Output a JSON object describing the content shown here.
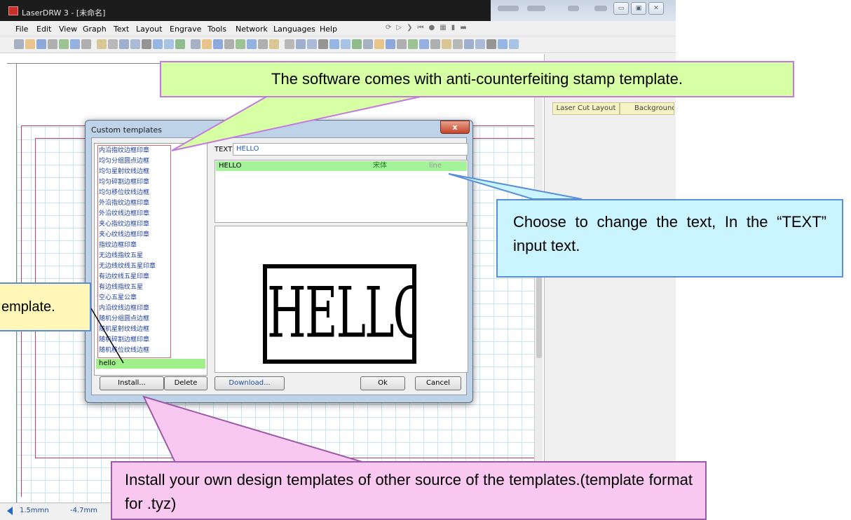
{
  "window": {
    "title": "LaserDRW 3 - [未命名]",
    "controls": [
      "▭",
      "▣",
      "✕"
    ]
  },
  "menu": [
    {
      "label": "File",
      "key": "F"
    },
    {
      "label": "Edit",
      "key": "E"
    },
    {
      "label": "View",
      "key": "V"
    },
    {
      "label": "Graph",
      "key": ""
    },
    {
      "label": "Text",
      "key": "T"
    },
    {
      "label": "Layout",
      "key": ""
    },
    {
      "label": "Engrave",
      "key": ""
    },
    {
      "label": "Tools",
      "key": ""
    },
    {
      "label": "Network",
      "key": "N"
    },
    {
      "label": "Languages",
      "key": "L"
    },
    {
      "label": "Help",
      "key": "H"
    }
  ],
  "ruler": {
    "unit": "mm"
  },
  "right_panel": {
    "tab_laser": "Laser Cut Layout",
    "tab_background": "Background"
  },
  "status": {
    "x": "1.5mmn",
    "y": "-4.7mm"
  },
  "dialog": {
    "title": "Custom templates",
    "close": "x",
    "templates": [
      "内沿指纹边框印章",
      "均匀分组圆点边框",
      "均匀星射纹线边框",
      "均匀碎割边框印章",
      "均匀移位纹线边框",
      "外沿指纹边框印章",
      "外沿纹线边框印章",
      "夹心指纹边框印章",
      "夹心纹线边框印章",
      "指纹边框印章",
      "无边线指纹五星",
      "无边线纹线五星印章",
      "有边纹线五星印章",
      "有边线指纹五星",
      "空心五星公章",
      "内沿纹线边框印章",
      "随机分组圆点边框",
      "随机星射纹线边框",
      "随机碎割边框印章",
      "随机移位纹线边框"
    ],
    "selected_template": "hello",
    "text_label": "TEXT",
    "text_value": "HELLO",
    "text_rows": [
      {
        "text": "HELLO",
        "font": "宋体",
        "mode": "line"
      }
    ],
    "preview_text": "HELLO",
    "buttons": {
      "install": "Install...",
      "delete": "Delete",
      "download": "Download...",
      "ok": "Ok",
      "cancel": "Cancel"
    }
  },
  "callouts": {
    "top": "The software comes with anti-counterfeiting stamp template.",
    "right": "Choose to change the text, In the “TEXT” input text.",
    "left": "emplate.",
    "bottom": "Install your own design templates of other source of the templates.(template format for .tyz)"
  },
  "colors": {
    "callout_top": "#d7ffa3",
    "callout_right": "#caf4ff",
    "callout_left": "#fff6b7",
    "callout_bottom": "#f9c8f1",
    "selection": "#9ff08a"
  }
}
